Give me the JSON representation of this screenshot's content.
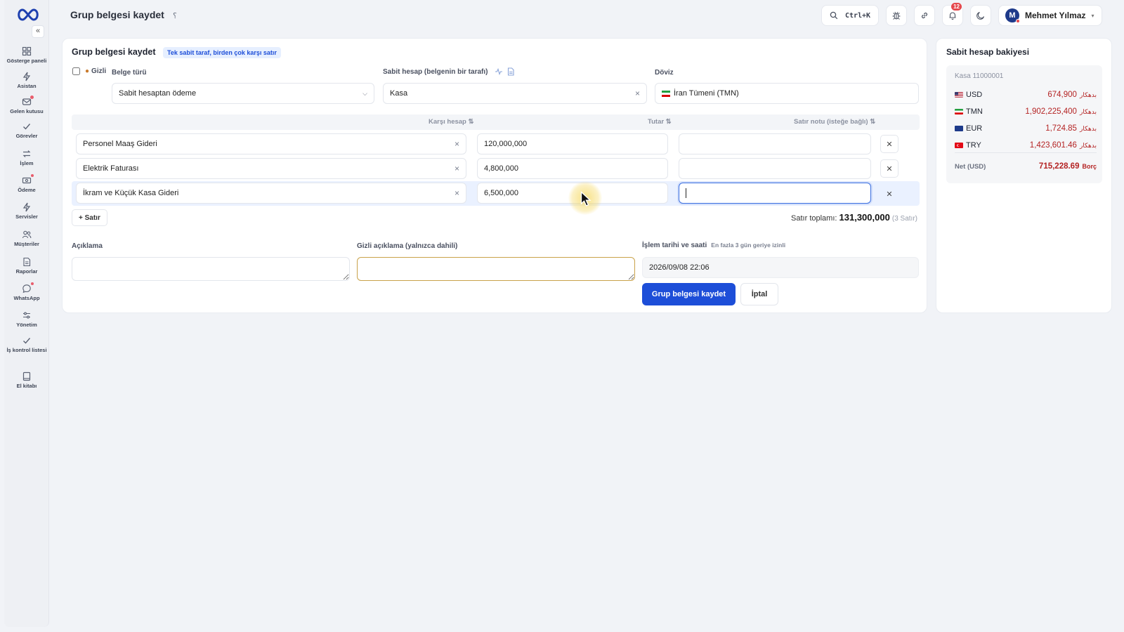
{
  "sidebar": {
    "collapse_glyph": "«",
    "items": [
      {
        "label": "Gösterge paneli",
        "icon": "dashboard-icon"
      },
      {
        "label": "Asistan",
        "icon": "bolt-icon"
      },
      {
        "label": "Gelen kutusu",
        "icon": "inbox-icon"
      },
      {
        "label": "Görevler",
        "icon": "check-icon"
      },
      {
        "label": "İşlem",
        "icon": "transfer-icon"
      },
      {
        "label": "Ödeme",
        "icon": "payment-icon"
      },
      {
        "label": "Servisler",
        "icon": "bolt-icon"
      },
      {
        "label": "Müşteriler",
        "icon": "users-icon"
      },
      {
        "label": "Raporlar",
        "icon": "report-icon"
      },
      {
        "label": "WhatsApp",
        "icon": "chat-icon"
      },
      {
        "label": "Yönetim",
        "icon": "sliders-icon"
      },
      {
        "label": "İş kontrol listesi",
        "icon": "checklist-icon"
      },
      {
        "label": "El kitabı",
        "icon": "book-icon"
      }
    ]
  },
  "header": {
    "title": "Grup belgesi kaydet",
    "help_glyph": "؟",
    "search_shortcut": "Ctrl+K",
    "notif_count": "12",
    "user_initial": "M",
    "user_name": "Mehmet Yılmaz",
    "caret_glyph": "▾"
  },
  "form": {
    "title": "Grup belgesi kaydet",
    "subtitle_pill": "Tek sabit taraf, birden çok karşı satır",
    "hidden_label": "Gizli",
    "doc_type_label": "Belge türü",
    "doc_type_value": "Sabit hesaptan ödeme",
    "fixed_account_label": "Sabit hesap (belgenin bir tarafı)",
    "fixed_account_value": "Kasa",
    "currency_label": "Döviz",
    "currency_value": "İran Tümeni (TMN)",
    "table": {
      "headers": {
        "counter_account": "Karşı hesap ⇅",
        "amount": "Tutar ⇅",
        "line_note": "Satır notu (isteğe bağlı) ⇅"
      },
      "rows": [
        {
          "account": "Personel Maaş Gideri",
          "amount": "120,000,000",
          "note": ""
        },
        {
          "account": "Elektrik Faturası",
          "amount": "4,800,000",
          "note": ""
        },
        {
          "account": "İkram ve Küçük Kasa Gideri",
          "amount": "6,500,000",
          "note": ""
        }
      ]
    },
    "add_row_label": "+ Satır",
    "total_label": "Satır toplamı:",
    "total_value": "131,300,000",
    "total_count": "(3 Satır)",
    "description_label": "Açıklama",
    "private_description_label": "Gizli açıklama (yalnızca dahili)",
    "datetime_label": "İşlem tarihi ve saati",
    "datetime_hint": "En fazla 3 gün geriye izinli",
    "datetime_value": "2026/09/08 22:06",
    "save_button": "Grup belgesi kaydet",
    "cancel_button": "İptal"
  },
  "balance": {
    "title": "Sabit hesap bakiyesi",
    "account": "Kasa 11000001",
    "unit": "بدهکار",
    "rows": [
      {
        "code": "USD",
        "amount": "674,900"
      },
      {
        "code": "TMN",
        "amount": "1,902,225,400"
      },
      {
        "code": "EUR",
        "amount": "1,724.85"
      },
      {
        "code": "TRY",
        "amount": "1,423,601.46"
      }
    ],
    "net_label": "Net (USD)",
    "net_value": "715,228.69",
    "net_suffix": "Borç"
  },
  "colors": {
    "primary": "#1d4ed8",
    "debit_red": "#b42323",
    "badge_red": "#e5484d"
  }
}
